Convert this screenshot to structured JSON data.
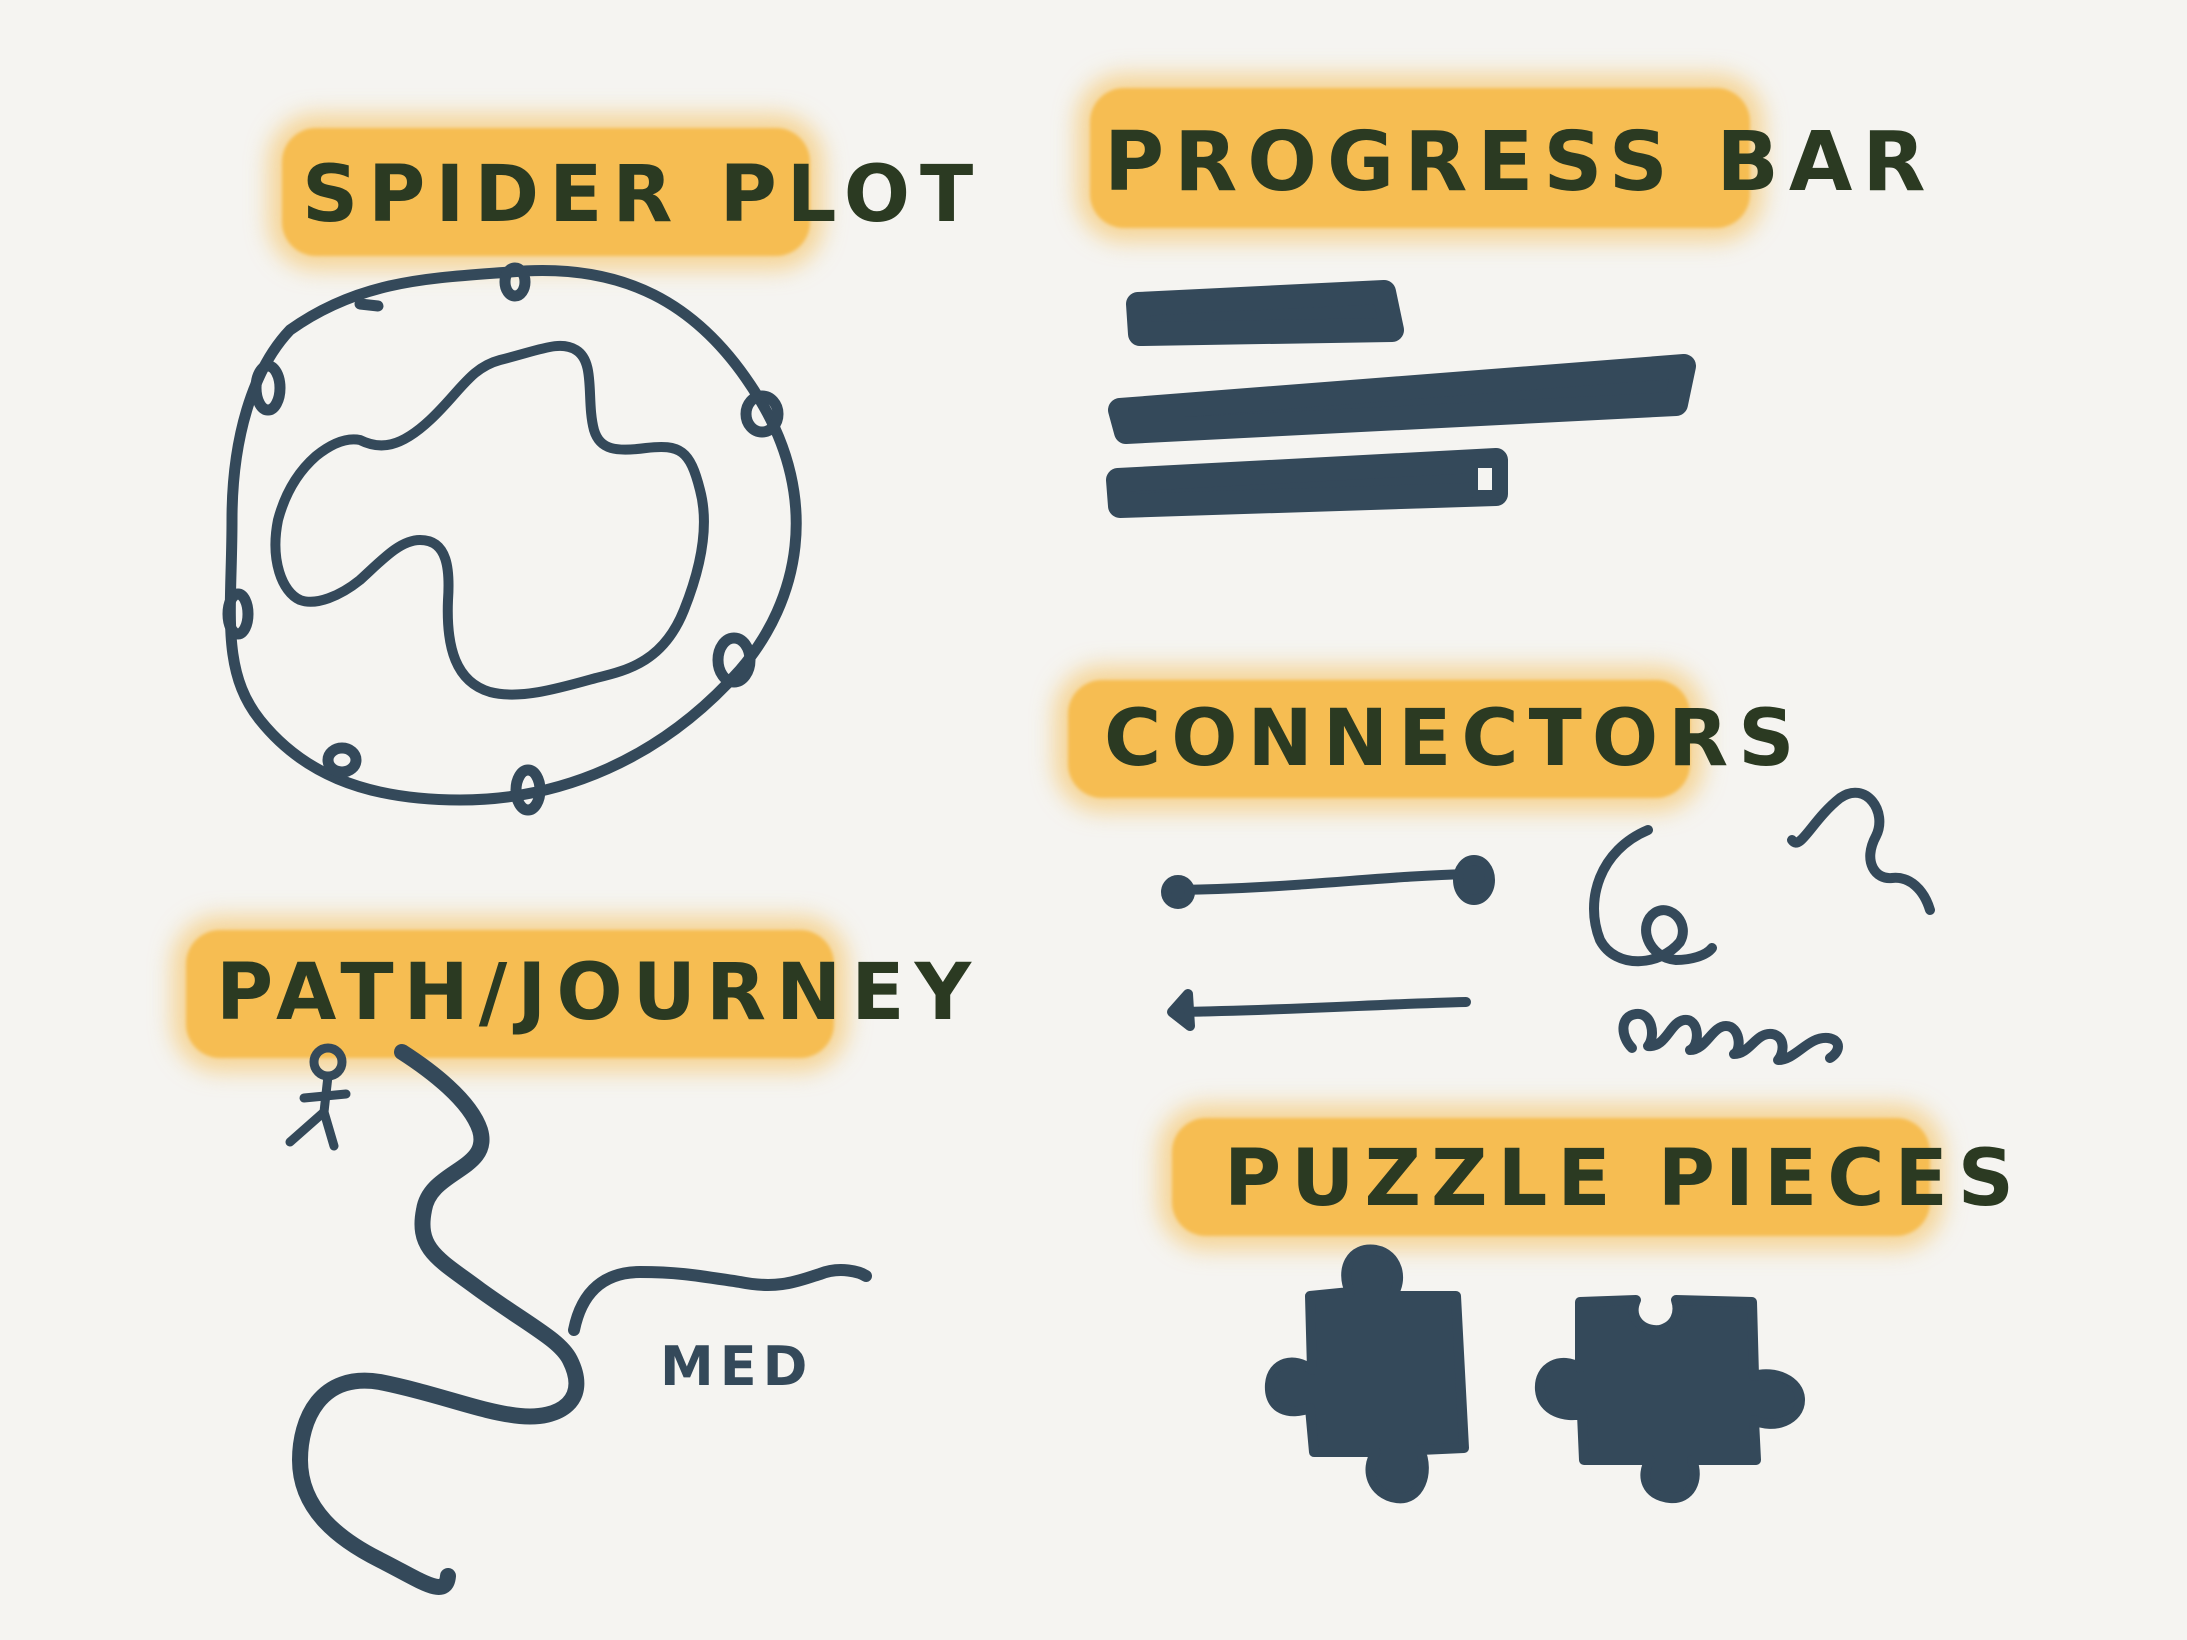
{
  "labels": {
    "spider_plot": "SPIDER PLOT",
    "progress_bar": "PROGRESS BAR",
    "connectors": "CONNECTORS",
    "path_journey": "PATH/JOURNEY",
    "puzzle_pieces": "PUZZLE PIECES"
  },
  "annotations": {
    "path_marker": "MED"
  },
  "progress_bars": [
    {
      "fill": 1.0
    },
    {
      "fill": 1.0
    },
    {
      "fill": 1.0
    }
  ],
  "colors": {
    "background": "#f5f4f1",
    "ink": "#34495a",
    "highlight": "#f6bd52",
    "label_text": "#2b3a22"
  },
  "icons": [
    "stick-figure-icon",
    "puzzle-piece-icon",
    "spiral-connector-icon",
    "squiggle-connector-icon",
    "loop-connector-icon"
  ]
}
